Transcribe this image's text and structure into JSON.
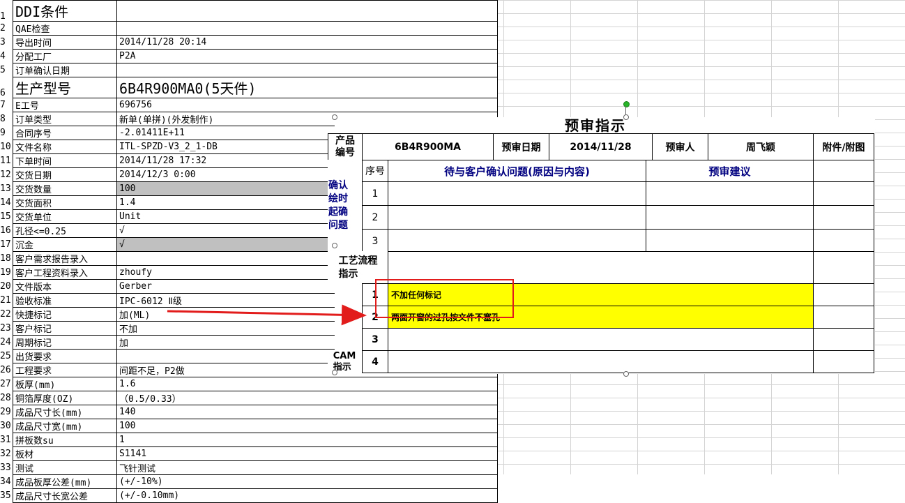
{
  "sheet": {
    "rows": [
      {
        "n": "1",
        "label": "DDI条件",
        "value": "",
        "big": true
      },
      {
        "n": "2",
        "label": "QAE检查",
        "value": ""
      },
      {
        "n": "3",
        "label": "导出时间",
        "value": "2014/11/28 20:14"
      },
      {
        "n": "4",
        "label": "分配工厂",
        "value": "P2A"
      },
      {
        "n": "5",
        "label": "订单确认日期",
        "value": ""
      },
      {
        "n": "6",
        "label": "生产型号",
        "value": "6B4R900MA0(5天件)",
        "big": true
      },
      {
        "n": "7",
        "label": "E工号",
        "value": "696756"
      },
      {
        "n": "8",
        "label": "订单类型",
        "value": "新单(单拼)(外发制作)"
      },
      {
        "n": "9",
        "label": "合同序号",
        "value": "-2.01411E+11"
      },
      {
        "n": "10",
        "label": "文件名称",
        "value": "ITL-SPZD-V3_2_1-DB"
      },
      {
        "n": "11",
        "label": "下单时间",
        "value": "2014/11/28 17:32"
      },
      {
        "n": "12",
        "label": "交货日期",
        "value": "2014/12/3 0:00"
      },
      {
        "n": "13",
        "label": "交货数量",
        "value": "100",
        "gray": true
      },
      {
        "n": "14",
        "label": "交货面积",
        "value": "1.4"
      },
      {
        "n": "15",
        "label": "交货单位",
        "value": "Unit"
      },
      {
        "n": "16",
        "label": "孔径<=0.25",
        "value": "√"
      },
      {
        "n": "17",
        "label": "沉金",
        "value": "√",
        "gray": true
      },
      {
        "n": "18",
        "label": "客户需求报告录入",
        "value": ""
      },
      {
        "n": "19",
        "label": "客户工程资料录入",
        "value": "zhoufy"
      },
      {
        "n": "20",
        "label": "文件版本",
        "value": "Gerber"
      },
      {
        "n": "21",
        "label": "验收标准",
        "value": "IPC-6012 Ⅱ级"
      },
      {
        "n": "22",
        "label": "快捷标记",
        "value": "加(ML)"
      },
      {
        "n": "23",
        "label": "客户标记",
        "value": "不加"
      },
      {
        "n": "24",
        "label": "周期标记",
        "value": "加"
      },
      {
        "n": "25",
        "label": "出货要求",
        "value": ""
      },
      {
        "n": "26",
        "label": "工程要求",
        "value": "间距不足，P2做"
      },
      {
        "n": "27",
        "label": "板厚(mm)",
        "value": "1.6"
      },
      {
        "n": "28",
        "label": "铜箔厚度(OZ)",
        "value": "（0.5/0.33）"
      },
      {
        "n": "29",
        "label": "成品尺寸长(mm)",
        "value": "140"
      },
      {
        "n": "30",
        "label": "成品尺寸宽(mm)",
        "value": "100"
      },
      {
        "n": "31",
        "label": "拼板数su",
        "value": "1"
      },
      {
        "n": "32",
        "label": "板材",
        "value": "S1141"
      },
      {
        "n": "33",
        "label": "测试",
        "value": "飞针测试"
      },
      {
        "n": "34",
        "label": "成品板厚公差(mm)",
        "value": "(+/-10%)"
      },
      {
        "n": "35",
        "label": "成品尺寸长宽公差",
        "value": "(+/-0.10mm)"
      }
    ]
  },
  "panel": {
    "title": "预审指示",
    "product_label": "产品\n编号",
    "product_value": "6B4R900MA",
    "review_date_label": "预审日期",
    "review_date_value": "2014/11/28",
    "reviewer_label": "预审人",
    "reviewer_value": "周飞颖",
    "attachment_label": "附件/附图",
    "seq_label": "序号",
    "issue_header": "待与客户确认问题(原因与内容)",
    "suggestion_header": "预审建议",
    "confirm_side": "确认\n绘时\n起确\n问题",
    "confirm_rows": [
      "1",
      "2",
      "3"
    ],
    "flow_label": "工艺流程\n指示",
    "flow_rows": [
      {
        "n": "1",
        "text": "不加任何标记"
      },
      {
        "n": "2",
        "text": "两面开窗的过孔按文件不塞孔"
      }
    ],
    "cam_label": "CAM\n指示",
    "cam_rows": [
      "3",
      "4"
    ]
  },
  "colors": {
    "highlight": "#ffff00",
    "annotation": "#e21b1b",
    "header_text": "#000080"
  }
}
